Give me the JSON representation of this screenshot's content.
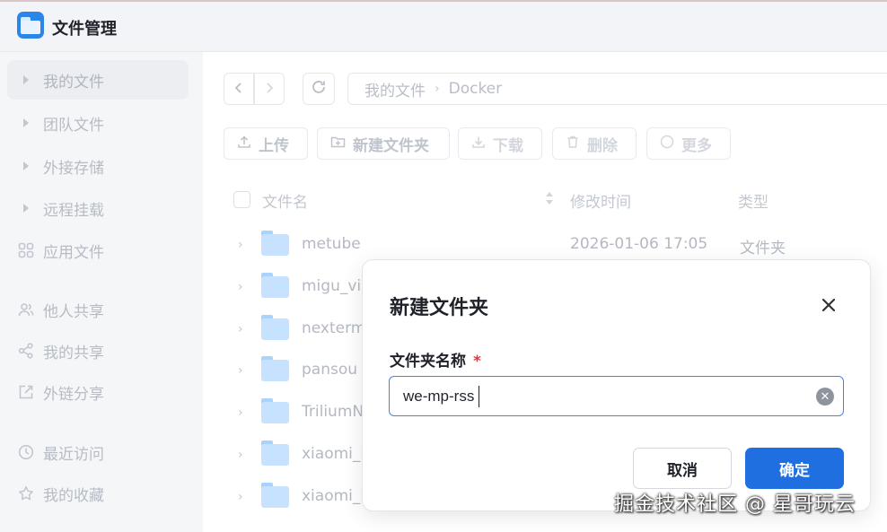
{
  "app": {
    "title": "文件管理",
    "icon": "folder-app-icon",
    "accent": "#1f6fe0"
  },
  "sidebar": {
    "items": [
      {
        "label": "我的文件",
        "icon": "caret-right-icon"
      },
      {
        "label": "团队文件",
        "icon": "caret-right-icon"
      },
      {
        "label": "外接存储",
        "icon": "caret-right-icon"
      },
      {
        "label": "远程挂载",
        "icon": "caret-right-icon"
      },
      {
        "label": "应用文件",
        "icon": "apps-grid-icon"
      },
      {
        "label": "他人共享",
        "icon": "users-icon"
      },
      {
        "label": "我的共享",
        "icon": "share-icon"
      },
      {
        "label": "外链分享",
        "icon": "external-link-icon"
      },
      {
        "label": "最近访问",
        "icon": "clock-icon"
      },
      {
        "label": "我的收藏",
        "icon": "star-icon"
      }
    ]
  },
  "breadcrumb": {
    "root": "我的文件",
    "current": "Docker"
  },
  "toolbar": {
    "upload": "上传",
    "new_folder": "新建文件夹",
    "download": "下载",
    "delete": "删除",
    "more": "更多"
  },
  "table": {
    "columns": {
      "name": "文件名",
      "modified": "修改时间",
      "type": "类型"
    },
    "rows": [
      {
        "name": "metube",
        "modified": "2026-01-06 17:05",
        "type": "文件夹"
      },
      {
        "name": "migu_vid",
        "modified": "",
        "type": ""
      },
      {
        "name": "nexterm",
        "modified": "",
        "type": ""
      },
      {
        "name": "pansou",
        "modified": "",
        "type": ""
      },
      {
        "name": "TriliumNe",
        "modified": "",
        "type": ""
      },
      {
        "name": "xiaomi_n",
        "modified": "",
        "type": ""
      },
      {
        "name": "xiaomi_n",
        "modified": "",
        "type": ""
      }
    ]
  },
  "dialog": {
    "title": "新建文件夹",
    "field_label": "文件夹名称",
    "required_mark": "*",
    "input_value": "we-mp-rss",
    "cancel": "取消",
    "confirm": "确定"
  },
  "watermark": "掘金技术社区 @ 星哥玩云"
}
